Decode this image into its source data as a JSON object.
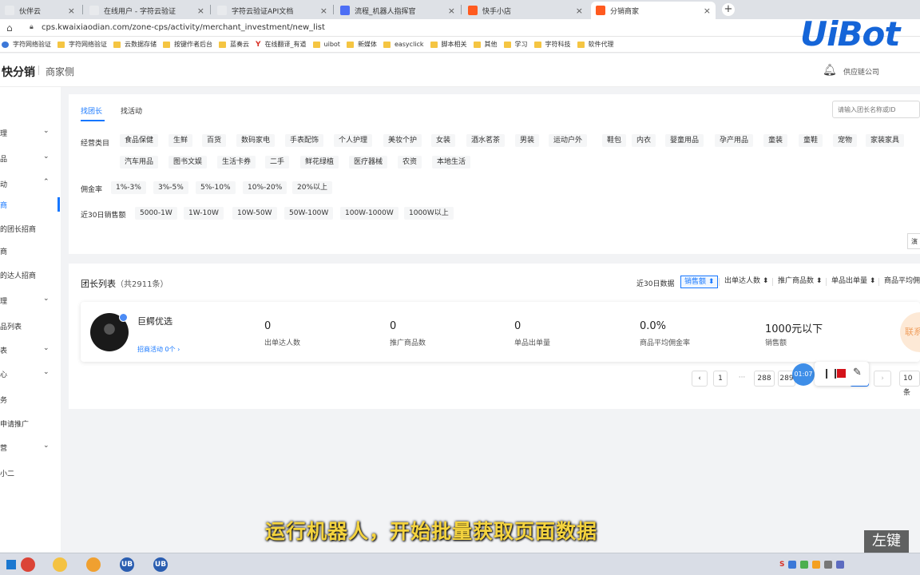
{
  "browser": {
    "tabs": [
      {
        "title": "伙伴云",
        "color": "#e8eaed"
      },
      {
        "title": "在线用户 - 字符云验证",
        "color": "#e8eaed"
      },
      {
        "title": "字符云验证API文档",
        "color": "#e8eaed"
      },
      {
        "title": "流程_机器人指挥官",
        "color": "#4c6ef5"
      },
      {
        "title": "快手小店",
        "color": "#ff5a1f"
      },
      {
        "title": "分销商家",
        "color": "#ff5a1f"
      }
    ],
    "active_tab": 5,
    "url": "cps.kwaixiaodian.com/zone-cps/activity/merchant_investment/new_list",
    "bookmarks": [
      {
        "label": "字符网络验证",
        "icon": "site"
      },
      {
        "label": "字符网络验证",
        "icon": "folder"
      },
      {
        "label": "云数据存储",
        "icon": "folder"
      },
      {
        "label": "按键作者后台",
        "icon": "folder"
      },
      {
        "label": "蓝奏云",
        "icon": "folder"
      },
      {
        "label": "在线翻译_有道",
        "icon": "youdao"
      },
      {
        "label": "uibot",
        "icon": "folder"
      },
      {
        "label": "新媒体",
        "icon": "folder"
      },
      {
        "label": "easyclick",
        "icon": "folder"
      },
      {
        "label": "脚本相关",
        "icon": "folder"
      },
      {
        "label": "其他",
        "icon": "folder"
      },
      {
        "label": "学习",
        "icon": "folder"
      },
      {
        "label": "字符科技",
        "icon": "folder"
      },
      {
        "label": "软件代理",
        "icon": "folder"
      }
    ],
    "watermark": "UiBot"
  },
  "app": {
    "brand": "快分销",
    "brand_sub": "商家侧",
    "company": "供应链公司"
  },
  "sidebar": {
    "items": [
      {
        "label": "理",
        "chevron": "down"
      },
      {
        "label": "品",
        "chevron": "down"
      },
      {
        "label": "动",
        "chevron": "up"
      },
      {
        "label": "商",
        "active": true
      },
      {
        "label": "的团长招商"
      },
      {
        "label": "商"
      },
      {
        "label": "的达人招商"
      },
      {
        "label": "理",
        "chevron": "down"
      },
      {
        "label": "品列表"
      },
      {
        "label": "表",
        "chevron": "down"
      },
      {
        "label": "心",
        "chevron": "down"
      },
      {
        "label": "务"
      },
      {
        "label": "申请推广"
      },
      {
        "label": "营",
        "chevron": "down"
      },
      {
        "label": "小二"
      }
    ]
  },
  "filter": {
    "tabs": [
      "找团长",
      "找活动"
    ],
    "active_tab": 0,
    "search_placeholder": "请输入团长名称或ID",
    "category_label": "经营类目",
    "categories_row1": [
      "食品保健",
      "生鲜",
      "百货",
      "数码家电",
      "手表配饰",
      "个人护理",
      "美妆个护",
      "女装",
      "酒水茗茶",
      "男装",
      "运动户外",
      "鞋包",
      "内衣",
      "婴童用品",
      "孕产用品",
      "童装",
      "童鞋",
      "宠物",
      "家装家具"
    ],
    "categories_row2": [
      "汽车用品",
      "图书文娱",
      "生活卡券",
      "二手",
      "鲜花绿植",
      "医疗器械",
      "农资",
      "本地生活"
    ],
    "commission_label": "佣金率",
    "commission_options": [
      "1%-3%",
      "3%-5%",
      "5%-10%",
      "10%-20%",
      "20%以上"
    ],
    "sales_label": "近30日销售额",
    "sales_options": [
      "5000-1W",
      "1W-10W",
      "10W-50W",
      "50W-100W",
      "100W-1000W",
      "1000W以上"
    ],
    "more_button": "演"
  },
  "list": {
    "title": "团长列表",
    "count_prefix": "（共",
    "count": "2911",
    "count_suffix": "条）",
    "sort_label": "近30日数据",
    "sort_buttons": [
      "销售额 ⬍",
      "出单达人数 ⬍",
      "推广商品数 ⬍",
      "单品出单量 ⬍",
      "商品平均佣"
    ],
    "leader": {
      "name": "巨鳄优选",
      "activity": "招商活动  0个 ›",
      "stats": [
        {
          "value": "0",
          "label": "出单达人数"
        },
        {
          "value": "0",
          "label": "推广商品数"
        },
        {
          "value": "0",
          "label": "单品出单量"
        },
        {
          "value": "0.0%",
          "label": "商品平均佣金率"
        },
        {
          "value": "1000元以下",
          "label": "销售额"
        }
      ],
      "contact": "联系"
    },
    "pagination": {
      "prev": "‹",
      "pages": [
        "1",
        "···",
        "288",
        "289"
      ],
      "next": "›",
      "page_size": "10 条"
    }
  },
  "recorder": {
    "timer": "01:07",
    "pause": "❙❙",
    "pen": "✎"
  },
  "overlay": {
    "subtitle": "运行机器人，开始批量获取页面数据",
    "key_hint": "左键"
  },
  "taskbar": {
    "apps": [
      {
        "name": "chrome",
        "color": "#db4437"
      },
      {
        "name": "explorer",
        "color": "#f4c242"
      },
      {
        "name": "sync",
        "color": "#f0a030"
      },
      {
        "name": "uibot-1",
        "label": "UB",
        "color": "#2a5db0"
      },
      {
        "name": "uibot-2",
        "label": "UB",
        "color": "#2a5db0"
      }
    ],
    "tray_label": "S"
  }
}
